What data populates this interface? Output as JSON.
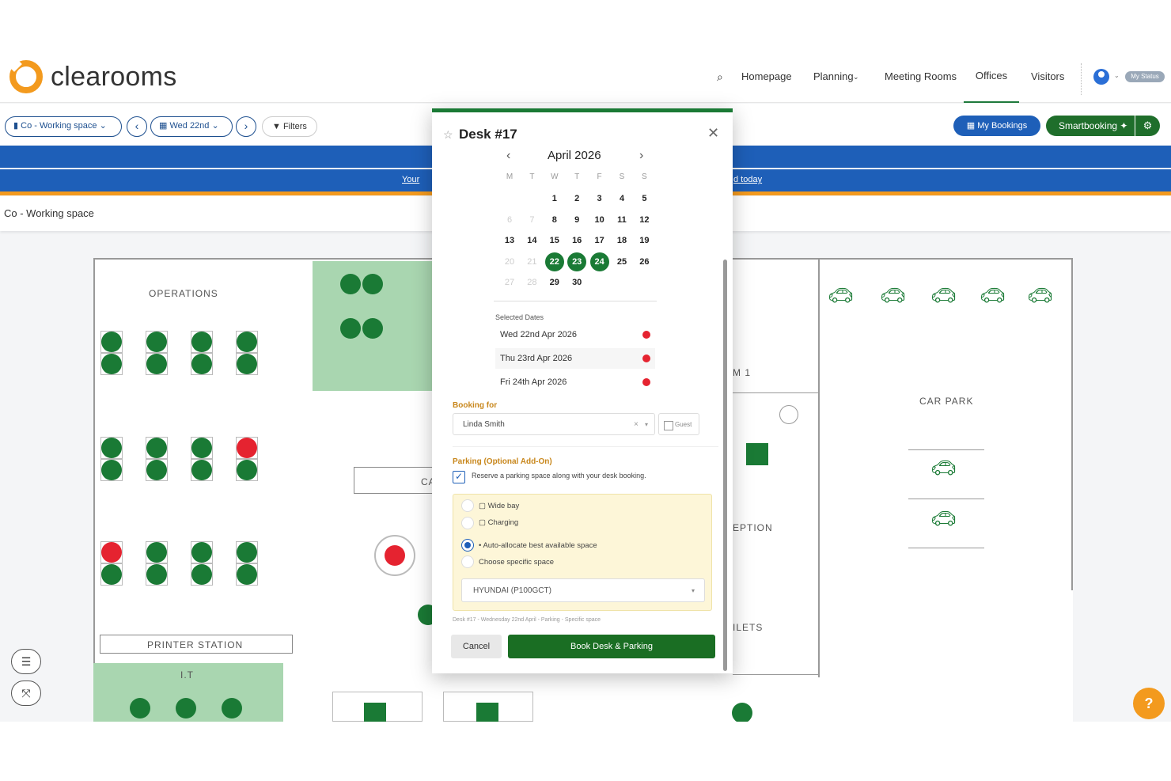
{
  "header": {
    "logo": "clearooms",
    "nav": [
      {
        "label": "Homepage"
      },
      {
        "label": "Planning"
      },
      {
        "label": "Meeting Rooms"
      },
      {
        "label": "Offices"
      },
      {
        "label": "Visitors"
      }
    ],
    "status": "My Status"
  },
  "toolbar": {
    "location": "Co - Working space",
    "date": "Wed 22nd",
    "filters": "Filters",
    "my_bookings": "My Bookings",
    "smart": "Smartbooking"
  },
  "banner": {
    "left": "Your",
    "right": "d today"
  },
  "breadcrumb": "Co - Working space",
  "plan": {
    "operations": "OPERATIONS",
    "printer": "PRINTER STATION",
    "it": "I.T",
    "car_park": "CAR PARK",
    "ca": "CA",
    "m1": "M 1",
    "eption": "EPTION",
    "ilets": "ILETS"
  },
  "modal": {
    "title": "Desk #17",
    "month": "April 2026",
    "dow": [
      "M",
      "T",
      "W",
      "T",
      "F",
      "S",
      "S"
    ],
    "days": [
      {
        "d": "1"
      },
      {
        "d": "2"
      },
      {
        "d": "3"
      },
      {
        "d": "4"
      },
      {
        "d": "5"
      },
      {
        "d": "6",
        "muted": true
      },
      {
        "d": "7",
        "muted": true
      },
      {
        "d": "8"
      },
      {
        "d": "9"
      },
      {
        "d": "10"
      },
      {
        "d": "11"
      },
      {
        "d": "12"
      },
      {
        "d": "13"
      },
      {
        "d": "14"
      },
      {
        "d": "15"
      },
      {
        "d": "16"
      },
      {
        "d": "17"
      },
      {
        "d": "18"
      },
      {
        "d": "19"
      },
      {
        "d": "20",
        "muted": true
      },
      {
        "d": "21",
        "muted": true
      },
      {
        "d": "22",
        "sel": true
      },
      {
        "d": "23",
        "sel": true
      },
      {
        "d": "24",
        "sel": true
      },
      {
        "d": "25"
      },
      {
        "d": "26"
      },
      {
        "d": "27",
        "muted": true
      },
      {
        "d": "28",
        "muted": true
      },
      {
        "d": "29"
      },
      {
        "d": "30"
      }
    ],
    "selected_label": "Selected Dates",
    "selected": [
      "Wed 22nd Apr 2026",
      "Thu 23rd Apr 2026",
      "Fri 24th Apr 2026"
    ],
    "booking_for_label": "Booking for",
    "booking_for": "Linda Smith",
    "guest": "Guest",
    "parking_label": "Parking (Optional Add-On)",
    "parking_check": "Reserve a parking space along with your desk booking.",
    "wide_bay": "Wide bay",
    "charging": "Charging",
    "auto": "• Auto-allocate best available space",
    "specific": "Choose specific space",
    "vehicle": "HYUNDAI (P100GCT)",
    "summary": "Desk #17 - Wednesday 22nd April - Parking - Specific space",
    "cancel": "Cancel",
    "book": "Book Desk & Parking"
  },
  "colors": {
    "green": "#1a7a35",
    "red": "#e52330",
    "blue": "#1e5fb8",
    "orange": "#f39a1e"
  }
}
